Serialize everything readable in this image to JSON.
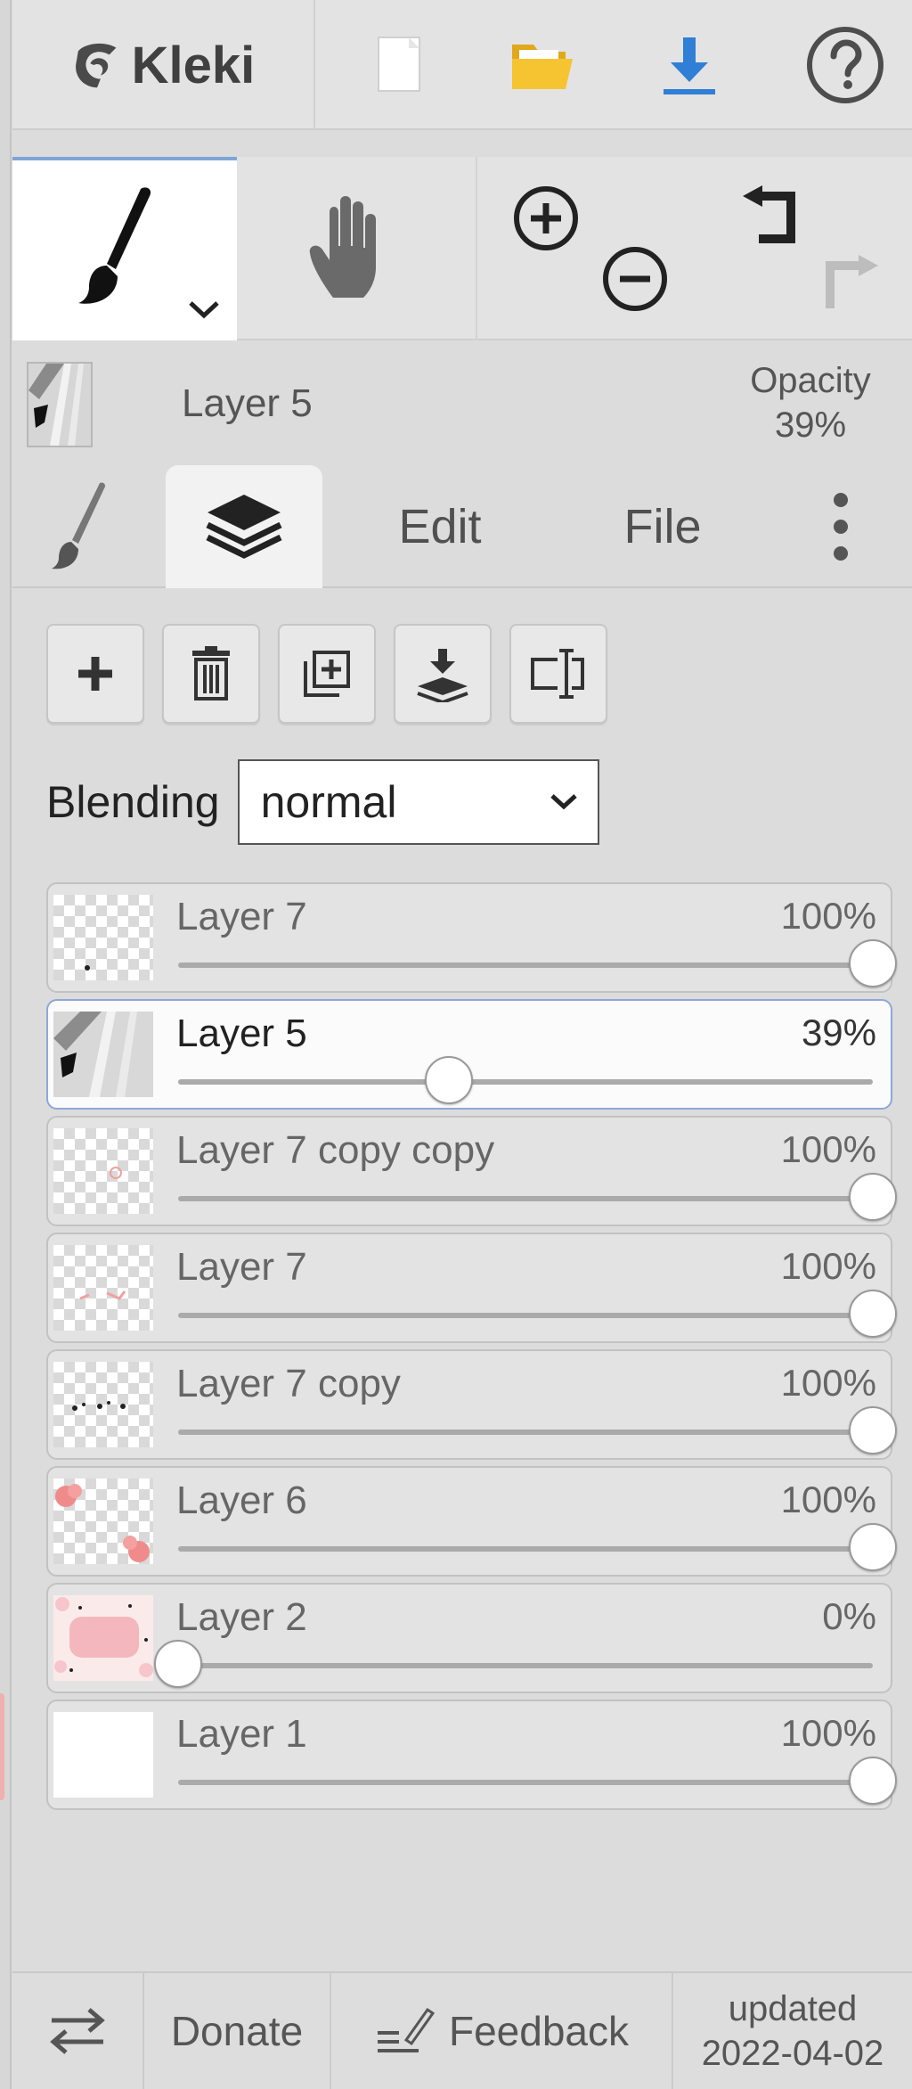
{
  "app": {
    "name": "Kleki"
  },
  "toolbar": {
    "icons": [
      "new-image-icon",
      "open-folder-icon",
      "download-icon",
      "help-icon"
    ],
    "colors": {
      "folder": "#f4c02c",
      "download": "#2f7fd6",
      "accent": "#7fa4d8"
    }
  },
  "tools": {
    "brush_icon": "brush-icon",
    "hand_icon": "hand-icon",
    "zoom_icons": [
      "zoom-in-icon",
      "zoom-out-icon"
    ],
    "history_icons": [
      "undo-icon",
      "redo-icon"
    ]
  },
  "current_layer": {
    "name": "Layer 5",
    "opacity_label": "Opacity",
    "opacity_value": "39%"
  },
  "tabs": {
    "brush_icon": "brush-icon",
    "layers_icon": "layers-icon",
    "edit": "Edit",
    "file": "File",
    "more_icon": "more-vertical-icon"
  },
  "layer_actions": [
    "add-layer-icon",
    "delete-layer-icon",
    "duplicate-layer-icon",
    "merge-down-icon",
    "rename-layer-icon"
  ],
  "blending": {
    "label": "Blending",
    "value": "normal"
  },
  "layers": [
    {
      "name": "Layer 7",
      "opacity": "100%",
      "level": 1.0,
      "selected": false
    },
    {
      "name": "Layer 5",
      "opacity": "39%",
      "level": 0.39,
      "selected": true
    },
    {
      "name": "Layer 7 copy copy",
      "opacity": "100%",
      "level": 1.0,
      "selected": false
    },
    {
      "name": "Layer 7",
      "opacity": "100%",
      "level": 1.0,
      "selected": false
    },
    {
      "name": "Layer 7 copy",
      "opacity": "100%",
      "level": 1.0,
      "selected": false
    },
    {
      "name": "Layer 6",
      "opacity": "100%",
      "level": 1.0,
      "selected": false
    },
    {
      "name": "Layer 2",
      "opacity": "0%",
      "level": 0.0,
      "selected": false
    },
    {
      "name": "Layer 1",
      "opacity": "100%",
      "level": 1.0,
      "selected": false
    }
  ],
  "footer": {
    "swap_icon": "swap-icon",
    "donate": "Donate",
    "feedback": "Feedback",
    "updated_label": "updated",
    "updated_date": "2022-04-02"
  }
}
